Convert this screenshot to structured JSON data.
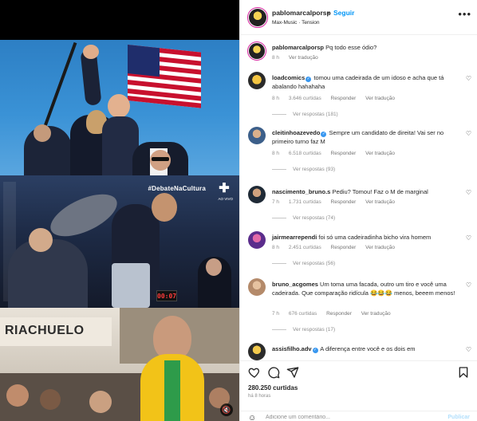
{
  "media": {
    "watermark": "#DebateNaCultura",
    "tv_badge": "AO VIVO",
    "clock": "00:07",
    "store_sign": "RIACHUELO",
    "mute_icon": "volume-muted-icon"
  },
  "header": {
    "username": "pablomarcalporsp",
    "separator": "•",
    "follow_label": "Seguir",
    "audio": "Max-Music · Tension",
    "more_icon": "more-icon"
  },
  "caption": {
    "username": "pablomarcalporsp",
    "text": "Pq todo esse ódio?",
    "time": "8 h",
    "translate": "Ver tradução"
  },
  "comments": [
    {
      "username": "loadcomics",
      "verified": true,
      "text": "tomou uma cadeirada de um idoso e acha que tá abalando hahahaha",
      "time": "8 h",
      "likes": "3.646 curtidas",
      "reply": "Responder",
      "translate": "Ver tradução",
      "replies": "Ver respostas (181)"
    },
    {
      "username": "cleitinhoazevedo",
      "verified": true,
      "text": "Sempre um candidato de direita! Vai ser no primeiro turno faz M",
      "time": "8 h",
      "likes": "6.518 curtidas",
      "reply": "Responder",
      "translate": "Ver tradução",
      "replies": "Ver respostas (93)"
    },
    {
      "username": "nascimento_bruno.s",
      "verified": false,
      "text": "Pediu? Tomou! Faz o M de marginal",
      "time": "7 h",
      "likes": "1.731 curtidas",
      "reply": "Responder",
      "translate": "Ver tradução",
      "replies": "Ver respostas (74)"
    },
    {
      "username": "jairmearrependi",
      "verified": false,
      "text": "foi só uma cadeiradinha bicho vira homem",
      "time": "8 h",
      "likes": "2.451 curtidas",
      "reply": "Responder",
      "translate": "Ver tradução",
      "replies": "Ver respostas (56)"
    },
    {
      "username": "bruno_acgomes",
      "verified": false,
      "text": "Um toma uma facada, outro um tiro e você uma cadeirada. Que comparação ridícula 😂😂😂 menos, beeem menos!",
      "time": "7 h",
      "likes": "676 curtidas",
      "reply": "Responder",
      "translate": "Ver tradução",
      "replies": "Ver respostas (17)"
    },
    {
      "username": "assisfilho.adv",
      "verified": true,
      "text": "A diferença entre você e os dois em",
      "time": "",
      "likes": "",
      "reply": "",
      "translate": "",
      "replies": ""
    }
  ],
  "actions": {
    "like_icon": "heart-icon",
    "comment_icon": "comment-icon",
    "share_icon": "send-icon",
    "save_icon": "bookmark-icon",
    "likes": "280.250 curtidas",
    "time_ago": "há 8 horas"
  },
  "add_comment": {
    "emoji_icon": "emoji-icon",
    "placeholder": "Adicione um comentário...",
    "publish_label": "Publicar"
  },
  "colors": {
    "link_blue": "#0095f6",
    "verified_blue": "#3897f0",
    "muted_text": "#8e8e8e",
    "publish_disabled": "#b2dffc"
  }
}
